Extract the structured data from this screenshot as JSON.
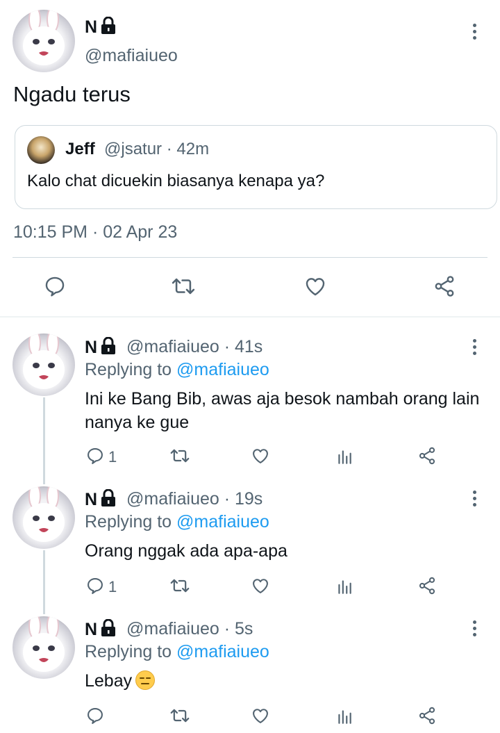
{
  "main_tweet": {
    "name": "N",
    "handle": "@mafiaiueo",
    "text": "Ngadu terus",
    "timestamp": "10:15 PM · 02 Apr 23",
    "quoted": {
      "name": "Jeff",
      "meta": "@jsatur · 42m",
      "text": "Kalo chat dicuekin biasanya kenapa ya?"
    }
  },
  "replies": [
    {
      "name": "N",
      "meta": "@mafiaiueo · 41s",
      "replying_label": "Replying to",
      "replying_to": "@mafiaiueo",
      "text": "Ini ke Bang Bib, awas aja besok nambah orang lain nanya ke gue",
      "reply_count": "1"
    },
    {
      "name": "N",
      "meta": "@mafiaiueo · 19s",
      "replying_label": "Replying to",
      "replying_to": "@mafiaiueo",
      "text": "Orang nggak ada apa-apa",
      "reply_count": "1"
    },
    {
      "name": "N",
      "meta": "@mafiaiueo · 5s",
      "replying_label": "Replying to",
      "replying_to": "@mafiaiueo",
      "text": "Lebay",
      "reply_count": ""
    }
  ],
  "colors": {
    "accent": "#1d9bf0",
    "secondary_text": "#536471",
    "divider": "#cfd9de"
  },
  "icons": {
    "reply": "comment-icon",
    "retweet": "retweet-icon",
    "like": "heart-icon",
    "views": "analytics-icon",
    "share": "share-icon",
    "lock": "lock-icon",
    "more": "more-vertical-icon"
  }
}
